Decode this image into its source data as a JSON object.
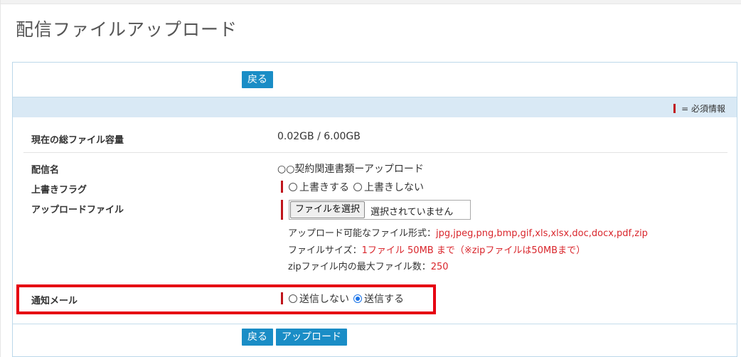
{
  "page": {
    "title": "配信ファイルアップロード"
  },
  "top_actions": {
    "back_label": "戻る"
  },
  "info_bar": {
    "required_legend": "= 必須情報"
  },
  "rows": {
    "total_capacity": {
      "label": "現在の総ファイル容量",
      "value": "0.02GB / 6.00GB"
    },
    "delivery_name": {
      "label": "配信名",
      "value": "○○契約関連書類ーアップロード"
    },
    "overwrite_flag": {
      "label": "上書きフラグ",
      "options": [
        {
          "label": "上書きする",
          "checked": false
        },
        {
          "label": "上書きしない",
          "checked": false
        }
      ]
    },
    "upload_file": {
      "label": "アップロードファイル",
      "choose_button": "ファイルを選択",
      "status": "選択されていません",
      "notes": {
        "formats_prefix": "アップロード可能なファイル形式：",
        "formats_value": "jpg,jpeg,png,bmp,gif,xls,xlsx,doc,docx,pdf,zip",
        "size_prefix": "ファイルサイズ：",
        "size_value": "1ファイル 50MB まで（※zipファイルは50MBまで）",
        "zip_prefix": "zipファイル内の最大ファイル数：",
        "zip_value": "250"
      }
    },
    "notify_mail": {
      "label": "通知メール",
      "options": [
        {
          "label": "送信しない",
          "checked": false
        },
        {
          "label": "送信する",
          "checked": true
        }
      ]
    }
  },
  "bottom_actions": {
    "back_label": "戻る",
    "upload_label": "アップロード"
  },
  "colors": {
    "button_blue": "#1a8dc6",
    "required_red": "#c0151c",
    "highlight_red": "#e60012",
    "info_bar_bg": "#d9e9f5"
  }
}
